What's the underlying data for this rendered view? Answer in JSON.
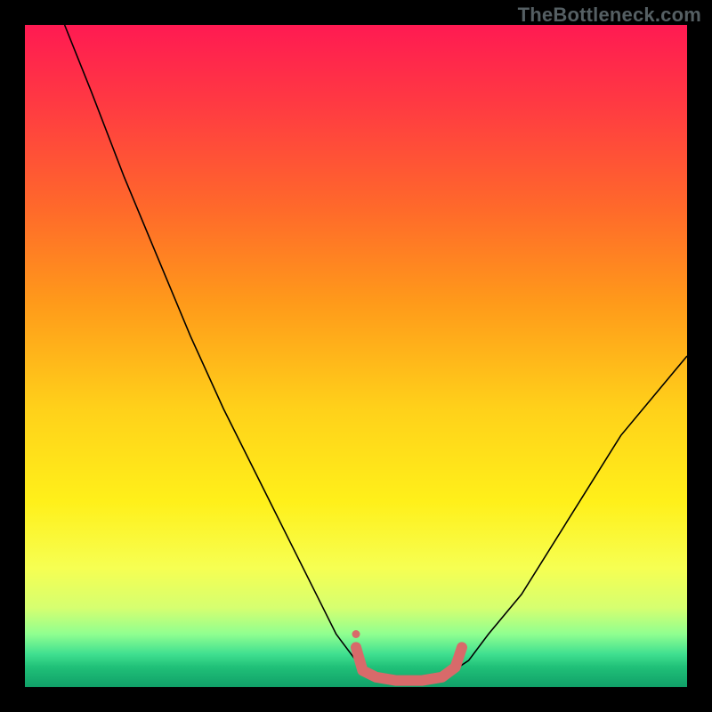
{
  "watermark": "TheBottleneck.com",
  "chart_data": {
    "type": "line",
    "title": "",
    "xlabel": "",
    "ylabel": "",
    "xlim": [
      0,
      100
    ],
    "ylim": [
      0,
      100
    ],
    "series": [
      {
        "name": "bottleneck-curve",
        "x": [
          6,
          10,
          15,
          20,
          25,
          30,
          35,
          40,
          44,
          47,
          50,
          53,
          56,
          60,
          64,
          67,
          70,
          75,
          80,
          85,
          90,
          95,
          100
        ],
        "y": [
          100,
          90,
          77,
          65,
          53,
          42,
          32,
          22,
          14,
          8,
          4,
          2,
          1,
          1,
          2,
          4,
          8,
          14,
          22,
          30,
          38,
          44,
          50
        ],
        "color": "#000000",
        "width": 1.6
      },
      {
        "name": "optimal-band-marker",
        "x": [
          50,
          51,
          53,
          56,
          60,
          63,
          65,
          66
        ],
        "y": [
          6,
          2.5,
          1.5,
          1,
          1,
          1.5,
          3,
          6
        ],
        "color": "#d86a6a",
        "width": 12
      },
      {
        "name": "optimal-start-dot",
        "x": [
          50
        ],
        "y": [
          8
        ],
        "color": "#d86a6a",
        "marker": "circle",
        "size": 9
      }
    ]
  }
}
